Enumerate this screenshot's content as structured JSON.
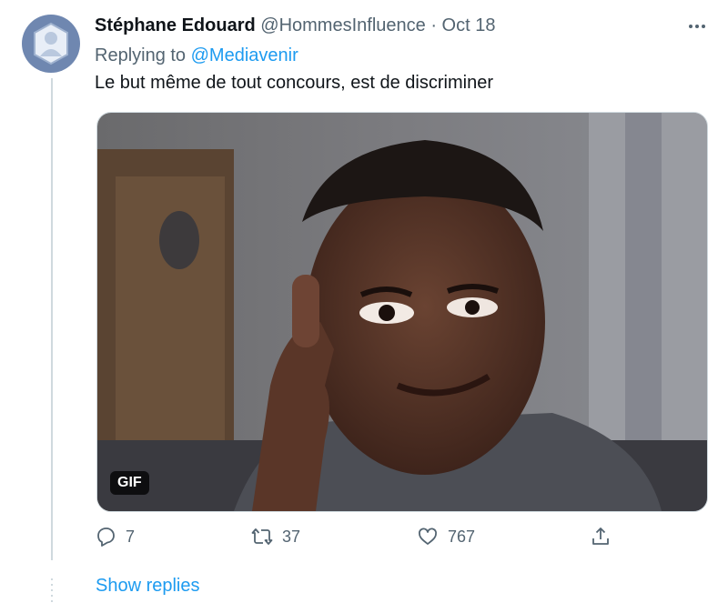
{
  "tweet": {
    "author_name": "Stéphane Edouard",
    "author_handle": "@HommesInfluence",
    "date_sep": "·",
    "date": "Oct 18",
    "reply_prefix": "Replying to",
    "reply_to": "@Mediavenir",
    "text": "Le but même de tout concours, est de discriminer",
    "media_badge": "GIF"
  },
  "actions": {
    "reply_count": "7",
    "retweet_count": "37",
    "like_count": "767"
  },
  "footer": {
    "show_replies": "Show replies"
  },
  "colors": {
    "accent": "#1d9bf0",
    "secondary_text": "#536471",
    "thread_line": "#cfd9de"
  },
  "icons": {
    "reply": "reply-icon",
    "retweet": "retweet-icon",
    "like": "heart-icon",
    "share": "share-icon",
    "more": "more-icon"
  }
}
